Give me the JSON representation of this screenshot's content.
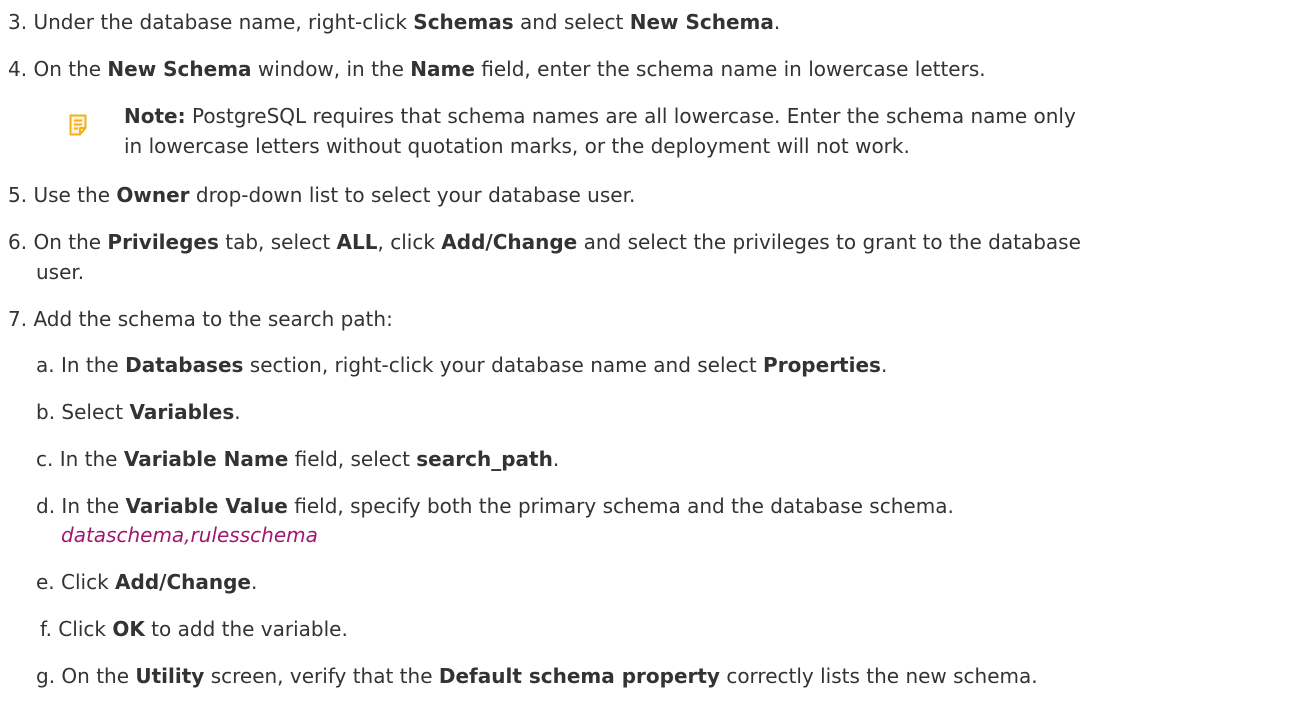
{
  "steps": {
    "s3": {
      "num": "3.",
      "t1": " Under the database name, right-click ",
      "b1": "Schemas",
      "t2": " and select ",
      "b2": "New Schema",
      "t3": "."
    },
    "s4": {
      "num": "4.",
      "t1": " On the ",
      "b1": "New Schema",
      "t2": " window, in the ",
      "b2": "Name",
      "t3": " field, enter the schema name in lowercase letters."
    },
    "note": {
      "icon": "note-icon",
      "label": "Note:",
      "line1": "  PostgreSQL requires that schema names are all lowercase. Enter the schema name only",
      "line2": "in lowercase letters without quotation marks, or the deployment will not work."
    },
    "s5": {
      "num": "5.",
      "t1": " Use the ",
      "b1": "Owner",
      "t2": " drop-down list to select your database user."
    },
    "s6": {
      "num": "6.",
      "t1": " On the ",
      "b1": "Privileges",
      "t2": " tab, select ",
      "b2": "ALL",
      "t3": ", click ",
      "b3": "Add/Change",
      "t4": " and select the privileges to grant to the database",
      "line2": "user."
    },
    "s7": {
      "num": "7.",
      "t1": " Add the schema to the search path:"
    },
    "sa": {
      "num": "a.",
      "t1": " In the ",
      "b1": "Databases",
      "t2": " section, right-click your database name and select ",
      "b2": "Properties",
      "t3": "."
    },
    "sb": {
      "num": "b.",
      "t1": " Select ",
      "b1": "Variables",
      "t2": "."
    },
    "sc": {
      "num": "c.",
      "t1": " In the ",
      "b1": "Variable Name",
      "t2": " field, select ",
      "b2": "search_path",
      "t3": "."
    },
    "sd": {
      "num": "d.",
      "t1": " In the ",
      "b1": "Variable Value",
      "t2": " field, specify both the primary schema and the database schema.",
      "code": "dataschema,rulesschema"
    },
    "se": {
      "num": "e.",
      "t1": " Click ",
      "b1": "Add/Change",
      "t2": "."
    },
    "sf": {
      "num": "f.",
      "t1": " Click ",
      "b1": "OK",
      "t2": " to add the variable."
    },
    "sg": {
      "num": "g.",
      "t1": " On the ",
      "b1": "Utility",
      "t2": " screen, verify that the ",
      "b2": "Default schema property",
      "t3": " correctly lists the new schema."
    }
  },
  "colors": {
    "text": "#333333",
    "code": "#a0186f",
    "note_icon": "#f2b01e"
  }
}
